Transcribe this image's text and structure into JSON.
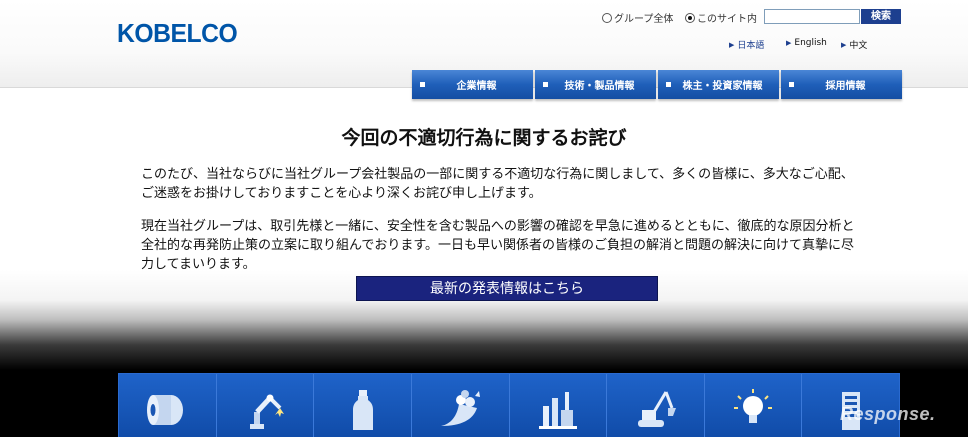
{
  "brand": {
    "logo_text": "KOBELCO",
    "accent": "#0055a8"
  },
  "search": {
    "scope_group": "グループ全体",
    "scope_site": "このサイト内",
    "selected_scope": "このサイト内",
    "input_value": "",
    "button_label": "検索"
  },
  "languages": [
    {
      "label": "日本語",
      "current": true
    },
    {
      "label": "English",
      "current": false
    },
    {
      "label": "中文",
      "current": false
    }
  ],
  "nav": [
    {
      "label": "企業情報"
    },
    {
      "label": "技術・製品情報"
    },
    {
      "label": "株主・投資家情報"
    },
    {
      "label": "採用情報"
    }
  ],
  "notice": {
    "title": "今回の不適切行為に関するお詫び",
    "paragraph1": "このたび、当社ならびに当社グループ会社製品の一部に関する不適切な行為に関しまして、多くの皆様に、多大なご心配、ご迷惑をお掛けしておりますことを心より深くお詫び申し上げます。",
    "paragraph2": "現在当社グループは、取引先様と一緒に、安全性を含む製品への影響の確認を早急に進めるとともに、徹底的な原因分析と全社的な再発防止策の立案に取り組んでおります。一日も早い関係者の皆様のご負担の解消と問題の解決に向けて真摯に尽力してまいります。",
    "latest_button": "最新の発表情報はこちら"
  },
  "product_tiles": [
    {
      "icon": "steel-coil-icon"
    },
    {
      "icon": "welding-robot-icon"
    },
    {
      "icon": "bottle-icon"
    },
    {
      "icon": "cornucopia-icon"
    },
    {
      "icon": "industrial-plant-icon"
    },
    {
      "icon": "construction-machinery-icon"
    },
    {
      "icon": "light-bulb-icon"
    },
    {
      "icon": "building-icon"
    }
  ],
  "watermark": "Response."
}
